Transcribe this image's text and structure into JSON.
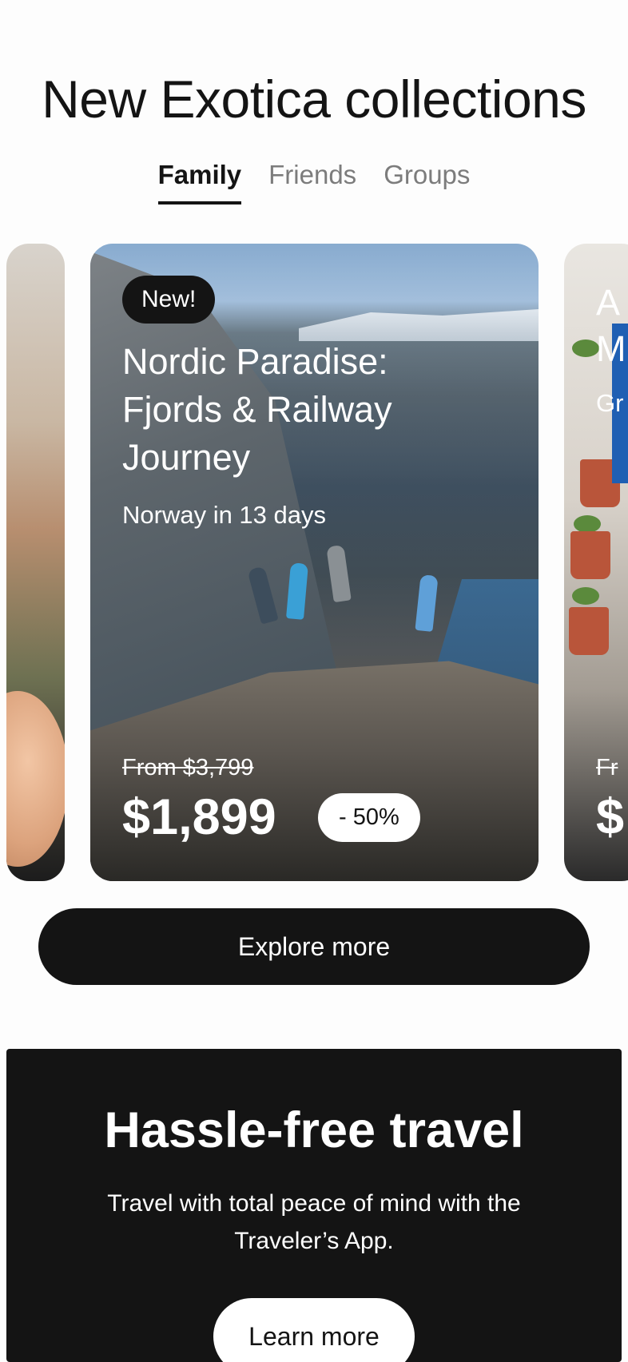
{
  "section": {
    "title": "New Exotica collections"
  },
  "tabs": [
    {
      "label": "Family",
      "active": true
    },
    {
      "label": "Friends",
      "active": false
    },
    {
      "label": "Groups",
      "active": false
    }
  ],
  "featured_card": {
    "badge": "New!",
    "title": "Nordic Paradise: Fjords & Railway Journey",
    "subtitle": "Norway in 13 days",
    "price_old": "From $3,799",
    "price_new": "$1,899",
    "discount": "- 50%"
  },
  "right_card": {
    "title_fragment_1": "A",
    "title_fragment_2": "M",
    "subtitle_fragment": "Gr",
    "price_old_fragment": "Fr",
    "price_new_fragment": "$"
  },
  "explore": {
    "label": "Explore more"
  },
  "promo": {
    "title": "Hassle-free travel",
    "text": "Travel with total peace of mind with the Traveler’s App.",
    "button_label": "Learn more"
  },
  "colors": {
    "primary": "#141414",
    "background": "#fdfdfd",
    "muted_tab": "#7c7c7c"
  }
}
